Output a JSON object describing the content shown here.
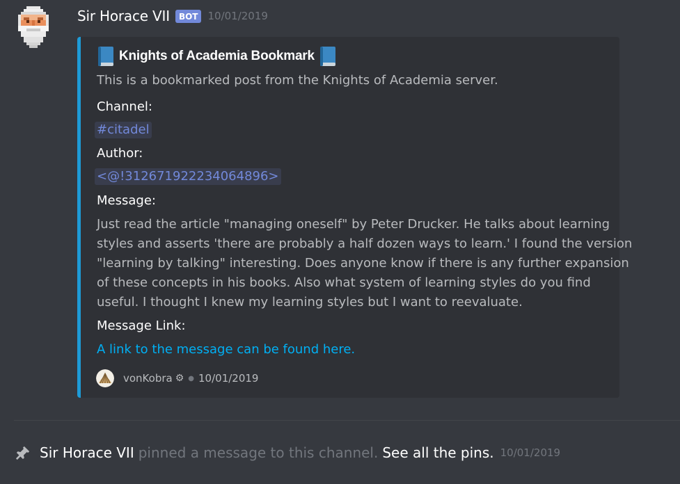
{
  "message": {
    "author": "Sir Horace VII",
    "bot_tag": "BOT",
    "timestamp": "10/01/2019"
  },
  "embed": {
    "title": "Knights of Academia Bookmark",
    "description": "This is a bookmarked post from the Knights of Academia server.",
    "fields": {
      "channel_name": "Channel:",
      "channel_value": "#citadel",
      "author_name": "Author:",
      "author_value": "<@!312671922234064896>",
      "message_name": "Message:",
      "message_lines": [
        "Just read the article \"managing oneself\" by Peter Drucker. He talks about learning",
        "styles and asserts 'there are probably a half dozen ways to learn.' I found the version",
        "\"learning by talking\" interesting. Does anyone know if there is any further expansion",
        "of these concepts in his books. Also what system of learning styles do you find",
        "useful. I thought I knew my learning styles but I want to reevaluate."
      ],
      "link_name": "Message Link:",
      "link_value": "A link to the message can be found here."
    },
    "footer": {
      "author": "vonKobra",
      "timestamp": "10/01/2019"
    },
    "accent_color": "#1e9bd7"
  },
  "system_message": {
    "author": "Sir Horace VII",
    "text": "pinned a message to this channel.",
    "link": "See all the pins.",
    "timestamp": "10/01/2019"
  },
  "colors": {
    "background": "#36393f",
    "embed_background": "#2f3136",
    "mention": "#7289da",
    "link": "#00b0f4"
  }
}
